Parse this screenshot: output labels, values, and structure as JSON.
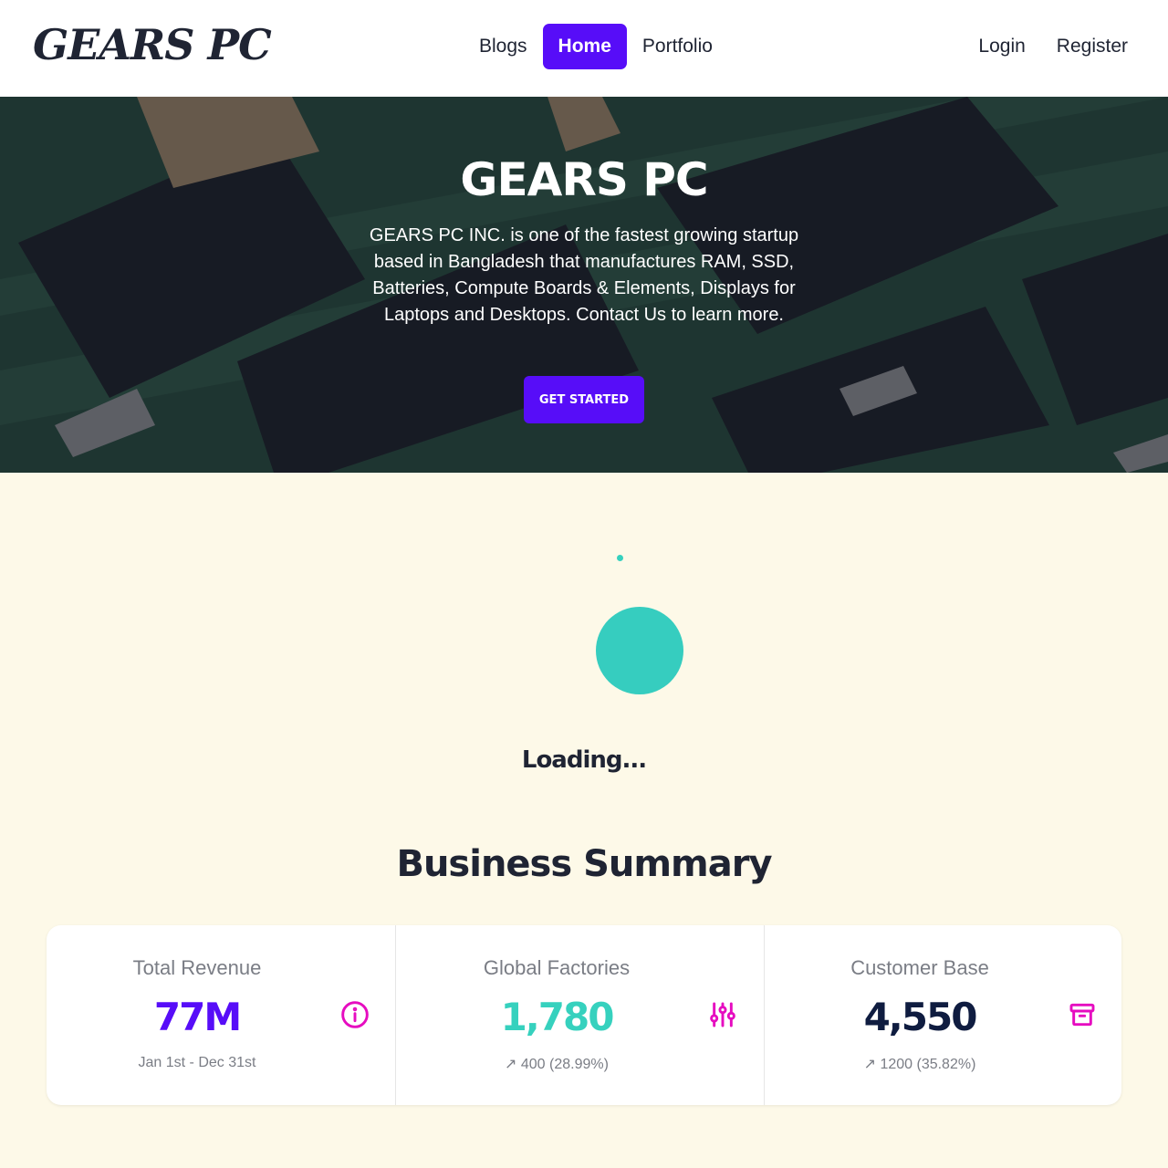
{
  "nav": {
    "logo": "GEARS PC",
    "links": [
      "Blogs",
      "Home",
      "Portfolio"
    ],
    "active": "Home",
    "auth": [
      "Login",
      "Register"
    ]
  },
  "hero": {
    "title": "GEARS PC",
    "description": "GEARS PC INC. is one of the fastest growing startup based in Bangladesh that manufactures RAM, SSD, Batteries, Compute Boards & Elements, Displays for Laptops and Desktops. Contact Us to learn more.",
    "cta": "GET STARTED"
  },
  "loading": {
    "text": "Loading..."
  },
  "summary": {
    "title": "Business Summary",
    "stats": [
      {
        "title": "Total Revenue",
        "value": "77M",
        "desc": "Jan 1st - Dec 31st",
        "icon": "info-circle-icon",
        "color": "#570df8"
      },
      {
        "title": "Global Factories",
        "value": "1,780",
        "desc": "↗︎ 400 (28.99%)",
        "icon": "sliders-icon",
        "color": "#36d1be"
      },
      {
        "title": "Customer Base",
        "value": "4,550",
        "desc": "↗︎ 1200 (35.82%)",
        "icon": "archive-icon",
        "color": "#0f1c40"
      }
    ]
  },
  "colors": {
    "primary": "#570df8",
    "secondary": "#e60cc0",
    "accent": "#36d1be",
    "background": "#fdf9e8"
  }
}
